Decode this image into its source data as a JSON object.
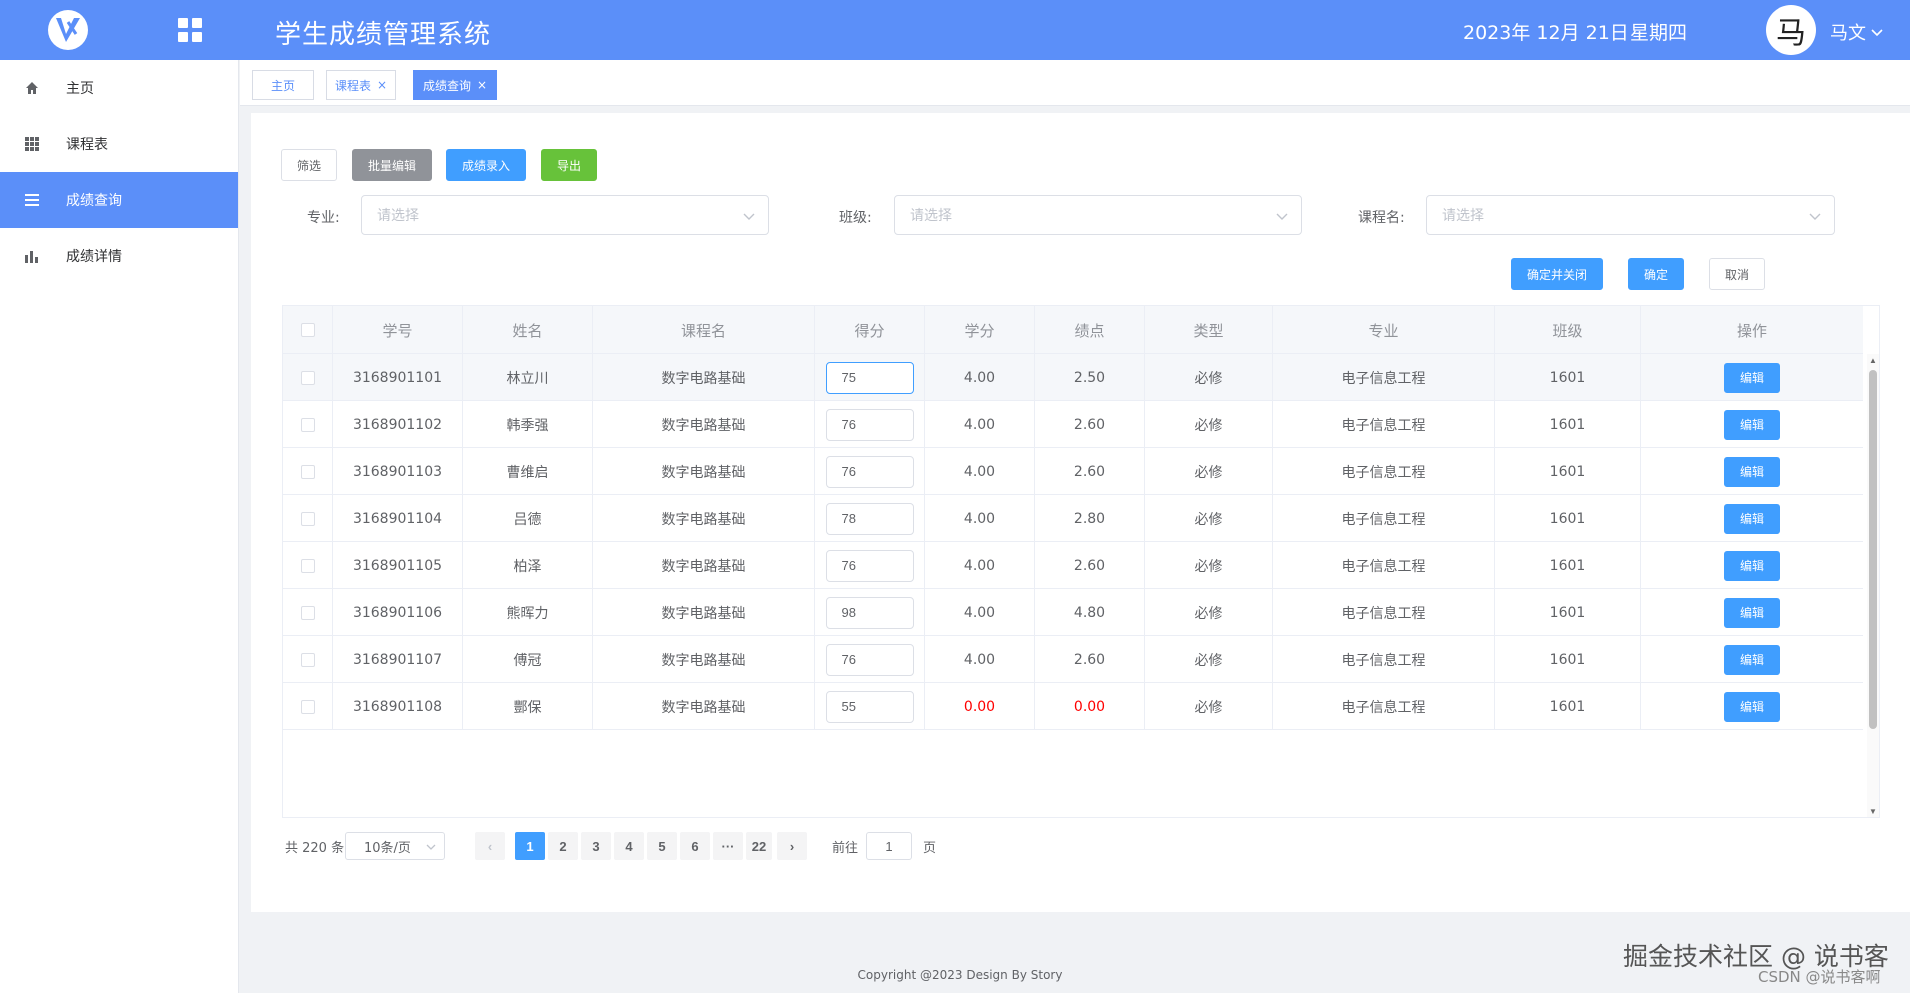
{
  "header": {
    "title": "学生成绩管理系统",
    "date": "2023年 12月 21日",
    "weekday": "星期四",
    "avatar_char": "马",
    "user_name": "马文"
  },
  "sidebar": {
    "items": [
      {
        "label": "主页",
        "icon": "home-icon"
      },
      {
        "label": "课程表",
        "icon": "grid-icon"
      },
      {
        "label": "成绩查询",
        "icon": "list-icon",
        "active": true
      },
      {
        "label": "成绩详情",
        "icon": "bar-chart-icon"
      }
    ]
  },
  "tags": [
    {
      "label": "主页",
      "closable": false
    },
    {
      "label": "课程表",
      "closable": true
    },
    {
      "label": "成绩查询",
      "closable": true,
      "active": true
    }
  ],
  "toolbar": {
    "filter_label": "筛选",
    "batch_edit_label": "批量编辑",
    "enter_score_label": "成绩录入",
    "export_label": "导出"
  },
  "filters": {
    "major_label": "专业:",
    "major_placeholder": "请选择",
    "class_label": "班级:",
    "class_placeholder": "请选择",
    "course_label": "课程名:",
    "course_placeholder": "请选择",
    "confirm_close_label": "确定并关闭",
    "confirm_label": "确定",
    "cancel_label": "取消"
  },
  "table": {
    "columns": [
      "学号",
      "姓名",
      "课程名",
      "得分",
      "学分",
      "绩点",
      "类型",
      "专业",
      "班级",
      "操作"
    ],
    "edit_label": "编辑",
    "rows": [
      {
        "id": "3168901101",
        "name": "林立川",
        "course": "数字电路基础",
        "score": "75",
        "credit": "4.00",
        "gpa": "2.50",
        "type": "必修",
        "major": "电子信息工程",
        "class": "1601"
      },
      {
        "id": "3168901102",
        "name": "韩季强",
        "course": "数字电路基础",
        "score": "76",
        "credit": "4.00",
        "gpa": "2.60",
        "type": "必修",
        "major": "电子信息工程",
        "class": "1601"
      },
      {
        "id": "3168901103",
        "name": "曹维启",
        "course": "数字电路基础",
        "score": "76",
        "credit": "4.00",
        "gpa": "2.60",
        "type": "必修",
        "major": "电子信息工程",
        "class": "1601"
      },
      {
        "id": "3168901104",
        "name": "吕德",
        "course": "数字电路基础",
        "score": "78",
        "credit": "4.00",
        "gpa": "2.80",
        "type": "必修",
        "major": "电子信息工程",
        "class": "1601"
      },
      {
        "id": "3168901105",
        "name": "柏泽",
        "course": "数字电路基础",
        "score": "76",
        "credit": "4.00",
        "gpa": "2.60",
        "type": "必修",
        "major": "电子信息工程",
        "class": "1601"
      },
      {
        "id": "3168901106",
        "name": "熊晖力",
        "course": "数字电路基础",
        "score": "98",
        "credit": "4.00",
        "gpa": "4.80",
        "type": "必修",
        "major": "电子信息工程",
        "class": "1601"
      },
      {
        "id": "3168901107",
        "name": "傅冠",
        "course": "数字电路基础",
        "score": "76",
        "credit": "4.00",
        "gpa": "2.60",
        "type": "必修",
        "major": "电子信息工程",
        "class": "1601"
      },
      {
        "id": "3168901108",
        "name": "酆保",
        "course": "数字电路基础",
        "score": "55",
        "credit": "0.00",
        "gpa": "0.00",
        "type": "必修",
        "major": "电子信息工程",
        "class": "1601",
        "fail": true
      }
    ]
  },
  "pagination": {
    "total_label": "共 220 条",
    "page_size": "10条/页",
    "pages": [
      "1",
      "2",
      "3",
      "4",
      "5",
      "6",
      "···",
      "22"
    ],
    "current": "1",
    "goto_label": "前往",
    "goto_value": "1",
    "page_suffix": "页"
  },
  "footer": "Copyright @2023 Design By Story",
  "watermark": {
    "line1": "掘金技术社区 @ 说书客",
    "line2": "CSDN @说书客啊"
  },
  "colors": {
    "primary": "#5b8ff9",
    "button_blue": "#409eff",
    "button_green": "#67c23a",
    "fail_red": "#ff0000"
  }
}
